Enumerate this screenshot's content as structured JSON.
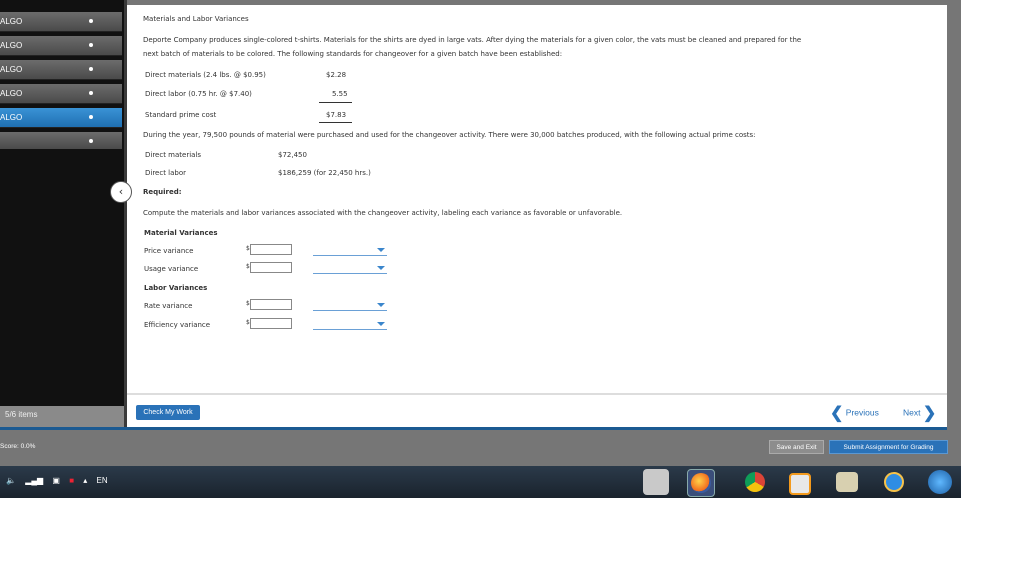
{
  "sidebar": {
    "items": [
      {
        "label": "ALGO",
        "active": false
      },
      {
        "label": "ALGO",
        "active": false
      },
      {
        "label": "ALGO",
        "active": false
      },
      {
        "label": "ALGO",
        "active": false
      },
      {
        "label": "ALGO",
        "active": true
      }
    ],
    "items_count": "5/6 items"
  },
  "problem": {
    "title": "Materials and Labor Variances",
    "intro_line1": "Deporte Company produces single-colored t-shirts. Materials for the shirts are dyed in large vats. After dying the materials for a given color, the vats must be cleaned and prepared for the",
    "intro_line2": "next batch of materials to be colored. The following standards for changeover for a given batch have been established:",
    "standards": [
      {
        "label": "Direct materials (2.4 lbs. @ $0.95)",
        "value": "$2.28"
      },
      {
        "label": "Direct labor (0.75 hr. @ $7.40)",
        "value": "5.55"
      },
      {
        "label": "Standard prime cost",
        "value": "$7.83"
      }
    ],
    "year_text": "During the year, 79,500 pounds of material were purchased and used for the changeover activity. There were 30,000 batches produced, with the following actual prime costs:",
    "actuals": [
      {
        "label": "Direct materials",
        "value": "$72,450"
      },
      {
        "label": "Direct labor",
        "value": "$186,259 (for 22,450 hrs.)"
      }
    ],
    "required_label": "Required:",
    "instruction": "Compute the materials and labor variances associated with the changeover activity, labeling each variance as favorable or unfavorable.",
    "material_header": "Material Variances",
    "labor_header": "Labor Variances",
    "rows": [
      {
        "label": "Price variance",
        "currency": "$",
        "value": "",
        "selection": ""
      },
      {
        "label": "Usage variance",
        "currency": "$",
        "value": "",
        "selection": ""
      },
      {
        "label": "Rate variance",
        "currency": "$",
        "value": "",
        "selection": ""
      },
      {
        "label": "Efficiency variance",
        "currency": "$",
        "value": "",
        "selection": ""
      }
    ]
  },
  "footer": {
    "check_label": "Check My Work",
    "previous_label": "Previous",
    "next_label": "Next",
    "score": "Score: 0.0%",
    "save_label": "Save and Exit",
    "submit_label": "Submit Assignment for Grading"
  },
  "taskbar": {
    "language": "EN"
  },
  "colors": {
    "accent": "#2a72b8",
    "sidebar_active": "#2b84cc",
    "frame": "#767676"
  },
  "icons": [
    "collapse-chevron-icon",
    "dropdown-arrow-icon",
    "previous-chevron-icon",
    "next-chevron-icon",
    "speaker-icon",
    "signal-icon",
    "network-icon",
    "adobe-icon",
    "tray-up-icon",
    "paint-icon",
    "firefox-icon",
    "chrome-icon",
    "media-player-icon",
    "notepad-icon",
    "ie-icon",
    "windows-icon"
  ]
}
